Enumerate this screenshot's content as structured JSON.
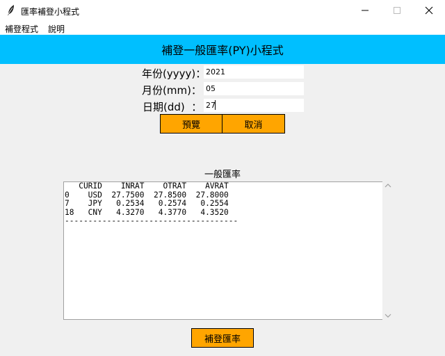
{
  "window": {
    "title": "匯率補登小程式",
    "icon": "feather-icon",
    "controls": [
      "minimize-icon",
      "maximize-icon",
      "close-icon"
    ]
  },
  "menu": {
    "items": [
      "補登程式",
      "說明"
    ]
  },
  "banner": {
    "title": "補登一般匯率(PY)小程式",
    "color": "#00bfff"
  },
  "form": {
    "year_label": "年份(yyyy)：",
    "year_value": "2021",
    "month_label": "月份(mm)：",
    "month_value": "05",
    "day_label": "日期(dd)  ：",
    "day_value": "27",
    "preview_button": "預覽",
    "cancel_button": "取消",
    "button_color": "#ffa500"
  },
  "rates": {
    "title": "一般匯率",
    "lines": [
      "   CURID    INRAT    OTRAT    AVRAT",
      "0    USD  27.7500  27.8500  27.8000",
      "7    JPY   0.2534   0.2574   0.2554",
      "18   CNY   4.3270   4.3770   4.3520",
      "-------------------------------------"
    ]
  },
  "submit_button": "補登匯率"
}
